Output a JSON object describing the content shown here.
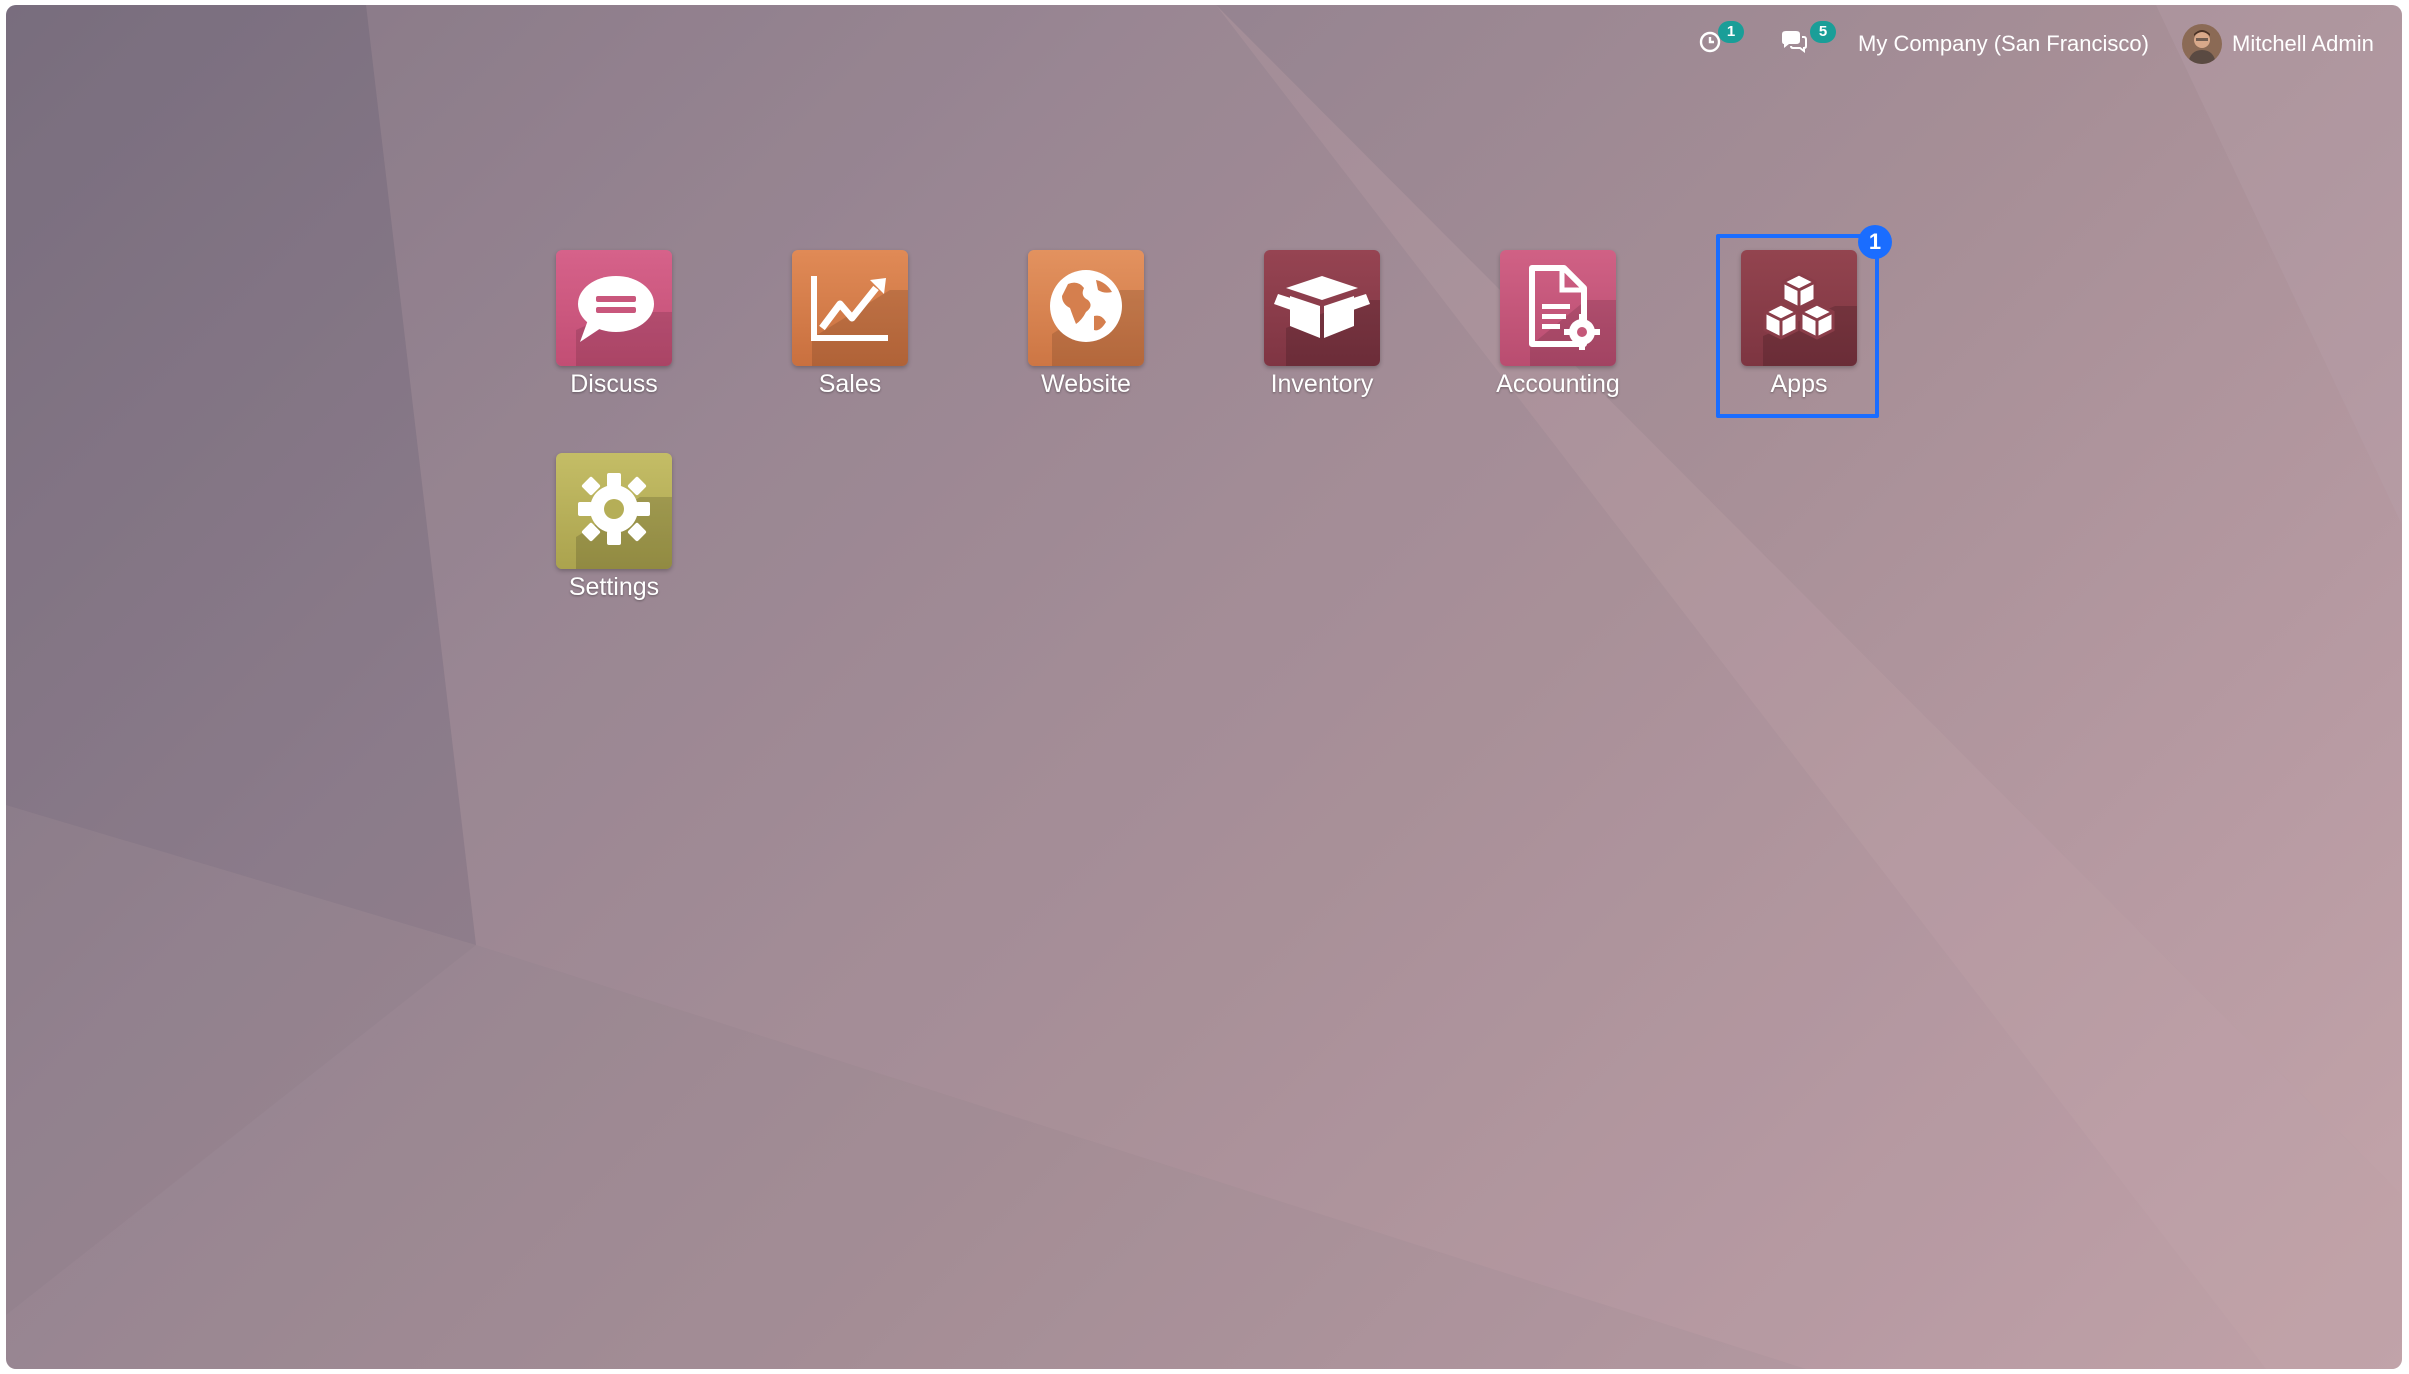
{
  "systray": {
    "activity": {
      "icon": "clock-icon",
      "count": "1"
    },
    "messages": {
      "icon": "chat-bubbles-icon",
      "count": "5"
    },
    "company": "My Company (San Francisco)",
    "user": {
      "name": "Mitchell Admin",
      "avatar": "user-avatar"
    }
  },
  "apps": [
    {
      "label": "Discuss",
      "icon": "speech-bubble-icon",
      "color": "#c9577c"
    },
    {
      "label": "Sales",
      "icon": "trend-chart-icon",
      "color": "#d0794a"
    },
    {
      "label": "Website",
      "icon": "globe-icon",
      "color": "#d57f4e"
    },
    {
      "label": "Inventory",
      "icon": "open-box-icon",
      "color": "#8c3c4c"
    },
    {
      "label": "Accounting",
      "icon": "document-gear-icon",
      "color": "#c45879"
    },
    {
      "label": "Apps",
      "icon": "cubes-icon",
      "color": "#8a3d49"
    },
    {
      "label": "Settings",
      "icon": "gear-icon",
      "color": "#b5ae57"
    }
  ],
  "highlight": {
    "target": "Apps",
    "marker": "1",
    "color": "#1a6dff"
  }
}
